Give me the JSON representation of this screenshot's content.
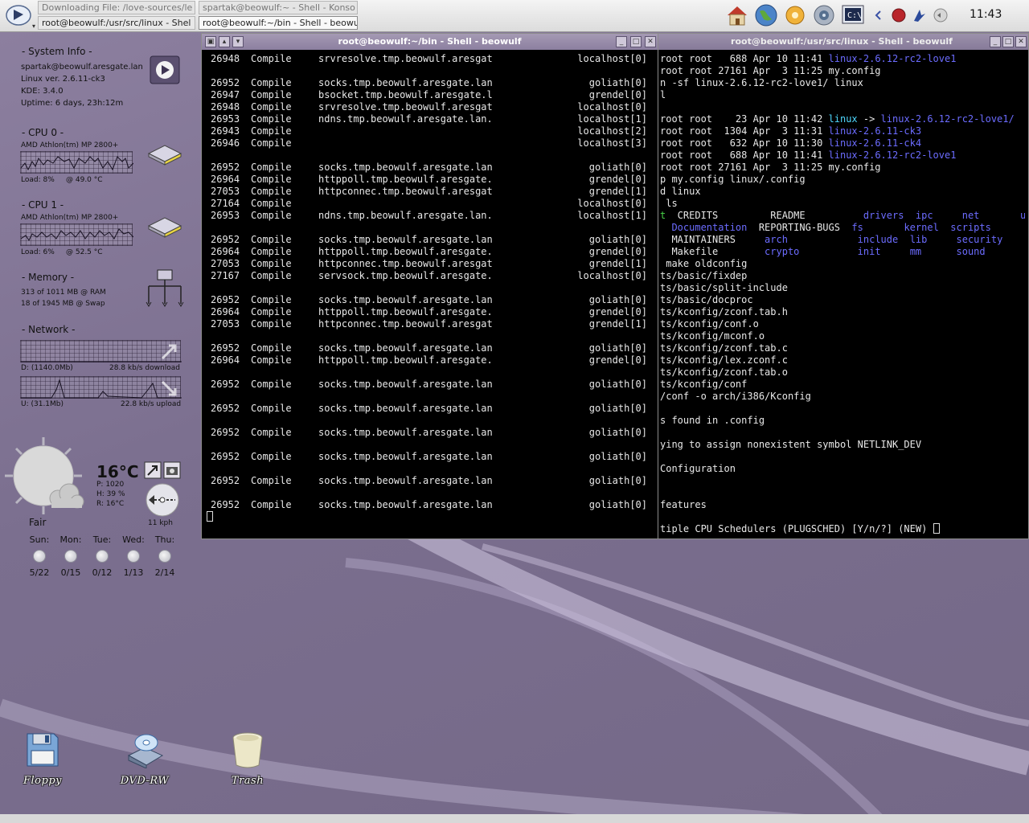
{
  "taskbar": {
    "tasks": [
      "Downloading File: /love-sources/le",
      "spartak@beowulf:~ - Shell - Konso",
      "root@beowulf:/usr/src/linux - Shel",
      "root@beowulf:~/bin - Shell - beowu"
    ],
    "clock": "11:43",
    "tray_icons": [
      "home-folder-icon",
      "konqueror-globe-icon",
      "config-icon",
      "speaker-icon",
      "konsole-icon"
    ]
  },
  "sysinfo": {
    "system_header": "- System Info -",
    "user": "spartak@beowulf.aresgate.lan",
    "linux": "Linux ver. 2.6.11-ck3",
    "kde": "KDE: 3.4.0",
    "uptime": "Uptime: 6 days, 23h:12m",
    "cpu0_header": "- CPU 0 -",
    "cpu0_model": "AMD Athlon(tm) MP 2800+",
    "cpu0_load": "Load: 8%",
    "cpu0_temp": "@ 49.0 °C",
    "cpu1_header": "- CPU 1 -",
    "cpu1_model": "AMD Athlon(tm) MP 2800+",
    "cpu1_load": "Load: 6%",
    "cpu1_temp": "@ 52.5 °C",
    "mem_header": "- Memory -",
    "ram": "313   of 1011 MB @ RAM",
    "swap": "18    of 1945 MB @ Swap",
    "net_header": "- Network -",
    "down_total": "D:   (1140.0Mb)",
    "down_rate": "28.8 kb/s download",
    "up_total": "U:   (31.1Mb)",
    "up_rate": "22.8 kb/s upload"
  },
  "weather": {
    "temp": "16°C",
    "pressure": "P: 1020",
    "humidity": "H: 39 %",
    "real": "R: 16°C",
    "wind": "11 kph",
    "condition": "Fair",
    "days": [
      {
        "name": "Sun:",
        "range": "5/22"
      },
      {
        "name": "Mon:",
        "range": "0/15"
      },
      {
        "name": "Tue:",
        "range": "0/12"
      },
      {
        "name": "Wed:",
        "range": "1/13"
      },
      {
        "name": "Thu:",
        "range": "2/14"
      }
    ]
  },
  "window_left": {
    "title": "root@beowulf:~/bin - Shell - beowulf",
    "rows": [
      {
        "pid": "26948",
        "state": "Compile",
        "host": "srvresolve.tmp.beowulf.aresgat",
        "target": "localhost[0]"
      },
      {
        "pid": "",
        "state": "",
        "host": "",
        "target": ""
      },
      {
        "pid": "26952",
        "state": "Compile",
        "host": "socks.tmp.beowulf.aresgate.lan",
        "target": "goliath[0]"
      },
      {
        "pid": "26947",
        "state": "Compile",
        "host": "bsocket.tmp.beowulf.aresgate.l",
        "target": "grendel[0]"
      },
      {
        "pid": "26948",
        "state": "Compile",
        "host": "srvresolve.tmp.beowulf.aresgat",
        "target": "localhost[0]"
      },
      {
        "pid": "26953",
        "state": "Compile",
        "host": "ndns.tmp.beowulf.aresgate.lan.",
        "target": "localhost[1]"
      },
      {
        "pid": "26943",
        "state": "Compile",
        "host": "",
        "target": "localhost[2]"
      },
      {
        "pid": "26946",
        "state": "Compile",
        "host": "",
        "target": "localhost[3]"
      },
      {
        "pid": "",
        "state": "",
        "host": "",
        "target": ""
      },
      {
        "pid": "26952",
        "state": "Compile",
        "host": "socks.tmp.beowulf.aresgate.lan",
        "target": "goliath[0]"
      },
      {
        "pid": "26964",
        "state": "Compile",
        "host": "httppoll.tmp.beowulf.aresgate.",
        "target": "grendel[0]"
      },
      {
        "pid": "27053",
        "state": "Compile",
        "host": "httpconnec.tmp.beowulf.aresgat",
        "target": "grendel[1]"
      },
      {
        "pid": "27164",
        "state": "Compile",
        "host": "",
        "target": "localhost[0]"
      },
      {
        "pid": "26953",
        "state": "Compile",
        "host": "ndns.tmp.beowulf.aresgate.lan.",
        "target": "localhost[1]"
      },
      {
        "pid": "",
        "state": "",
        "host": "",
        "target": ""
      },
      {
        "pid": "26952",
        "state": "Compile",
        "host": "socks.tmp.beowulf.aresgate.lan",
        "target": "goliath[0]"
      },
      {
        "pid": "26964",
        "state": "Compile",
        "host": "httppoll.tmp.beowulf.aresgate.",
        "target": "grendel[0]"
      },
      {
        "pid": "27053",
        "state": "Compile",
        "host": "httpconnec.tmp.beowulf.aresgat",
        "target": "grendel[1]"
      },
      {
        "pid": "27167",
        "state": "Compile",
        "host": "servsock.tmp.beowulf.aresgate.",
        "target": "localhost[0]"
      },
      {
        "pid": "",
        "state": "",
        "host": "",
        "target": ""
      },
      {
        "pid": "26952",
        "state": "Compile",
        "host": "socks.tmp.beowulf.aresgate.lan",
        "target": "goliath[0]"
      },
      {
        "pid": "26964",
        "state": "Compile",
        "host": "httppoll.tmp.beowulf.aresgate.",
        "target": "grendel[0]"
      },
      {
        "pid": "27053",
        "state": "Compile",
        "host": "httpconnec.tmp.beowulf.aresgat",
        "target": "grendel[1]"
      },
      {
        "pid": "",
        "state": "",
        "host": "",
        "target": ""
      },
      {
        "pid": "26952",
        "state": "Compile",
        "host": "socks.tmp.beowulf.aresgate.lan",
        "target": "goliath[0]"
      },
      {
        "pid": "26964",
        "state": "Compile",
        "host": "httppoll.tmp.beowulf.aresgate.",
        "target": "grendel[0]"
      },
      {
        "pid": "",
        "state": "",
        "host": "",
        "target": ""
      },
      {
        "pid": "26952",
        "state": "Compile",
        "host": "socks.tmp.beowulf.aresgate.lan",
        "target": "goliath[0]"
      },
      {
        "pid": "",
        "state": "",
        "host": "",
        "target": ""
      },
      {
        "pid": "26952",
        "state": "Compile",
        "host": "socks.tmp.beowulf.aresgate.lan",
        "target": "goliath[0]"
      },
      {
        "pid": "",
        "state": "",
        "host": "",
        "target": ""
      },
      {
        "pid": "26952",
        "state": "Compile",
        "host": "socks.tmp.beowulf.aresgate.lan",
        "target": "goliath[0]"
      },
      {
        "pid": "",
        "state": "",
        "host": "",
        "target": ""
      },
      {
        "pid": "26952",
        "state": "Compile",
        "host": "socks.tmp.beowulf.aresgate.lan",
        "target": "goliath[0]"
      },
      {
        "pid": "",
        "state": "",
        "host": "",
        "target": ""
      },
      {
        "pid": "26952",
        "state": "Compile",
        "host": "socks.tmp.beowulf.aresgate.lan",
        "target": "goliath[0]"
      },
      {
        "pid": "",
        "state": "",
        "host": "",
        "target": ""
      },
      {
        "pid": "26952",
        "state": "Compile",
        "host": "socks.tmp.beowulf.aresgate.lan",
        "target": "goliath[0]"
      }
    ]
  },
  "window_right": {
    "title": "root@beowulf:/usr/src/linux - Shell - beowulf",
    "lines": [
      [
        [
          "root root   688 Apr 10 11:41 ",
          ""
        ],
        [
          "linux-2.6.12-rc2-love1",
          "blue"
        ]
      ],
      [
        [
          "root root 27161 Apr  3 11:25 my.config",
          ""
        ]
      ],
      [
        [
          "n -sf linux-2.6.12-rc2-love1/ linux",
          ""
        ]
      ],
      [
        [
          "l",
          ""
        ]
      ],
      [
        [
          "",
          ""
        ]
      ],
      [
        [
          "root root    23 Apr 10 11:42 ",
          ""
        ],
        [
          "linux",
          "cyan"
        ],
        [
          " -> ",
          ""
        ],
        [
          "linux-2.6.12-rc2-love1/",
          "blue"
        ]
      ],
      [
        [
          "root root  1304 Apr  3 11:31 ",
          ""
        ],
        [
          "linux-2.6.11-ck3",
          "blue"
        ]
      ],
      [
        [
          "root root   632 Apr 10 11:30 ",
          ""
        ],
        [
          "linux-2.6.11-ck4",
          "blue"
        ]
      ],
      [
        [
          "root root   688 Apr 10 11:41 ",
          ""
        ],
        [
          "linux-2.6.12-rc2-love1",
          "blue"
        ]
      ],
      [
        [
          "root root 27161 Apr  3 11:25 my.config",
          ""
        ]
      ],
      [
        [
          "p my.config linux/.config",
          ""
        ]
      ],
      [
        [
          "d linux",
          ""
        ]
      ],
      [
        [
          " ls",
          ""
        ]
      ],
      [
        [
          "t",
          "green"
        ],
        [
          "  CREDITS         README          ",
          ""
        ],
        [
          "drivers",
          "blue"
        ],
        [
          "  ",
          ""
        ],
        [
          "ipc",
          "blue"
        ],
        [
          "     ",
          ""
        ],
        [
          "net",
          "blue"
        ],
        [
          "       ",
          ""
        ],
        [
          "usr",
          "blue"
        ]
      ],
      [
        [
          "  ",
          ""
        ],
        [
          "Documentation",
          "blue"
        ],
        [
          "  REPORTING-BUGS  ",
          ""
        ],
        [
          "fs",
          "blue"
        ],
        [
          "       ",
          ""
        ],
        [
          "kernel",
          "blue"
        ],
        [
          "  ",
          ""
        ],
        [
          "scripts",
          "blue"
        ]
      ],
      [
        [
          "  MAINTAINERS     ",
          ""
        ],
        [
          "arch",
          "blue"
        ],
        [
          "            ",
          ""
        ],
        [
          "include",
          "blue"
        ],
        [
          "  ",
          ""
        ],
        [
          "lib",
          "blue"
        ],
        [
          "     ",
          ""
        ],
        [
          "security",
          "blue"
        ]
      ],
      [
        [
          "  Makefile        ",
          ""
        ],
        [
          "crypto",
          "blue"
        ],
        [
          "          ",
          ""
        ],
        [
          "init",
          "blue"
        ],
        [
          "     ",
          ""
        ],
        [
          "mm",
          "blue"
        ],
        [
          "      ",
          ""
        ],
        [
          "sound",
          "blue"
        ]
      ],
      [
        [
          " make oldconfig",
          ""
        ]
      ],
      [
        [
          "ts/basic/fixdep",
          ""
        ]
      ],
      [
        [
          "ts/basic/split-include",
          ""
        ]
      ],
      [
        [
          "ts/basic/docproc",
          ""
        ]
      ],
      [
        [
          "ts/kconfig/zconf.tab.h",
          ""
        ]
      ],
      [
        [
          "ts/kconfig/conf.o",
          ""
        ]
      ],
      [
        [
          "ts/kconfig/mconf.o",
          ""
        ]
      ],
      [
        [
          "ts/kconfig/zconf.tab.c",
          ""
        ]
      ],
      [
        [
          "ts/kconfig/lex.zconf.c",
          ""
        ]
      ],
      [
        [
          "ts/kconfig/zconf.tab.o",
          ""
        ]
      ],
      [
        [
          "ts/kconfig/conf",
          ""
        ]
      ],
      [
        [
          "/conf -o arch/i386/Kconfig",
          ""
        ]
      ],
      [
        [
          "",
          ""
        ]
      ],
      [
        [
          "s found in .config",
          ""
        ]
      ],
      [
        [
          "",
          ""
        ]
      ],
      [
        [
          "ying to assign nonexistent symbol NETLINK_DEV",
          ""
        ]
      ],
      [
        [
          "",
          ""
        ]
      ],
      [
        [
          "Configuration",
          ""
        ]
      ],
      [
        [
          "",
          ""
        ]
      ],
      [
        [
          "",
          ""
        ]
      ],
      [
        [
          "features",
          ""
        ]
      ],
      [
        [
          "",
          ""
        ]
      ],
      [
        [
          "tiple CPU Schedulers (PLUGSCHED) [Y/n/?] (NEW) ",
          ""
        ]
      ]
    ]
  },
  "desktop_icons": [
    {
      "label": "Floppy",
      "icon": "floppy-icon"
    },
    {
      "label": "DVD-RW",
      "icon": "dvd-drive-icon"
    },
    {
      "label": "Trash",
      "icon": "trash-icon"
    }
  ],
  "colors": {
    "desktop": "#7e7090",
    "titlebar": "#9d92ad",
    "term_fg": "#e8e8e8",
    "term_link": "#6c6cff",
    "term_cyan": "#4fd8ff"
  }
}
